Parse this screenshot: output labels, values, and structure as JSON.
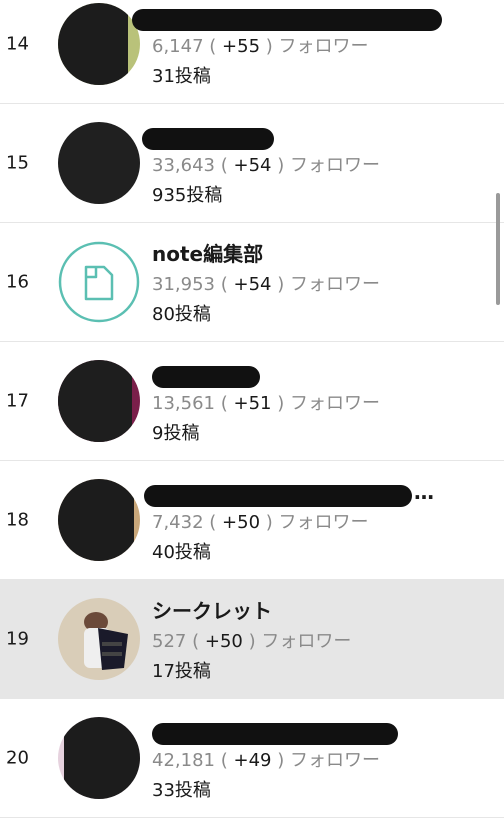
{
  "rows": [
    {
      "rank": "14",
      "name": "",
      "followers": "6,147",
      "increase": "+55",
      "follower_label": "フォロワー",
      "posts": "31",
      "posts_label": "投稿",
      "redacted": true
    },
    {
      "rank": "15",
      "name": "",
      "followers": "33,643",
      "increase": "+54",
      "follower_label": "フォロワー",
      "posts": "935",
      "posts_label": "投稿",
      "redacted": true
    },
    {
      "rank": "16",
      "name": "note編集部",
      "followers": "31,953",
      "increase": "+54",
      "follower_label": "フォロワー",
      "posts": "80",
      "posts_label": "投稿",
      "redacted": false
    },
    {
      "rank": "17",
      "name": "",
      "followers": "13,561",
      "increase": "+51",
      "follower_label": "フォロワー",
      "posts": "9",
      "posts_label": "投稿",
      "redacted": true
    },
    {
      "rank": "18",
      "name": "…",
      "followers": "7,432",
      "increase": "+50",
      "follower_label": "フォロワー",
      "posts": "40",
      "posts_label": "投稿",
      "redacted": true
    },
    {
      "rank": "19",
      "name": "シークレット",
      "followers": "527",
      "increase": "+50",
      "follower_label": "フォロワー",
      "posts": "17",
      "posts_label": "投稿",
      "redacted": false,
      "highlighted": true
    },
    {
      "rank": "20",
      "name": "",
      "followers": "42,181",
      "increase": "+49",
      "follower_label": "フォロワー",
      "posts": "33",
      "posts_label": "投稿",
      "redacted": true
    }
  ],
  "paren_open": "(",
  "paren_close": ")",
  "colors": {
    "accent_teal": "#5bbfb2",
    "highlight_row": "#e6e6e6",
    "redaction": "#111111"
  }
}
